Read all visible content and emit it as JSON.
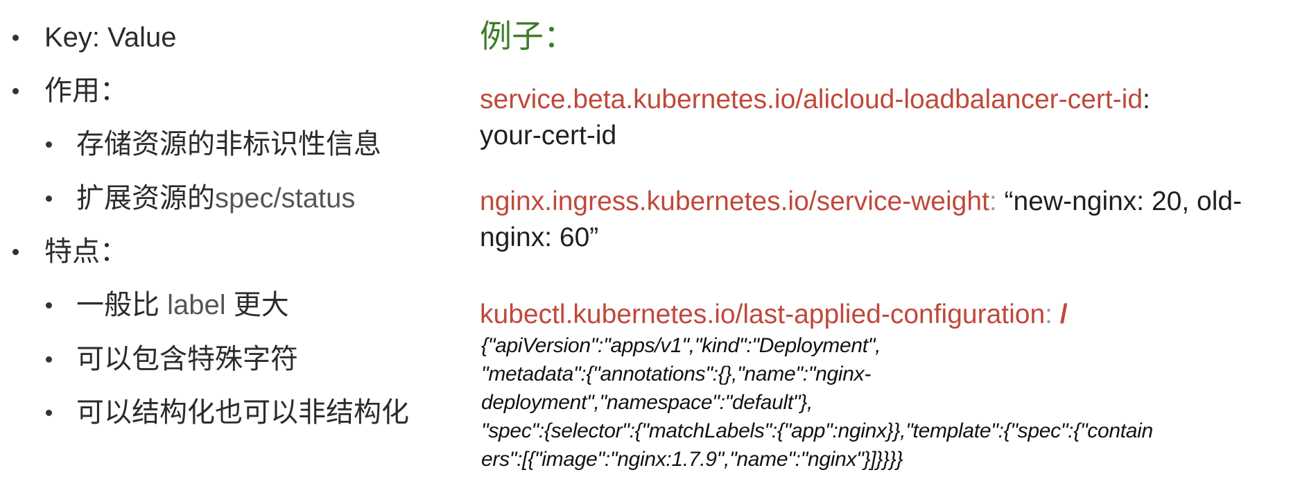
{
  "left_list": {
    "item_key_value": "Key: Value",
    "item_purpose": "作用：",
    "purpose_sub_1": "存储资源的非标识性信息",
    "purpose_sub_2_cn": "扩展资源的",
    "purpose_sub_2_en": "spec/status",
    "item_features": "特点：",
    "features_sub_1_a": "一般比 ",
    "features_sub_1_b": "label",
    "features_sub_1_c": " 更大",
    "features_sub_2": "可以包含特殊字符",
    "features_sub_3": "可以结构化也可以非结构化"
  },
  "example": {
    "heading": "例子：",
    "entry1_key": "service.beta.kubernetes.io/alicloud-loadbalancer-cert-id",
    "entry1_colon": ":",
    "entry1_value": "your-cert-id",
    "entry2_key": "nginx.ingress.kubernetes.io/service-weight",
    "entry2_colon": ":",
    "entry2_value": " “new-nginx: 20, old-nginx: 60”",
    "entry3_key": "kubectl.kubernetes.io/last-applied-configuration",
    "entry3_colon": ":",
    "entry3_slash": " /",
    "entry3_value": "{\"apiVersion\":\"apps/v1\",\"kind\":\"Deployment\",\n\"metadata\":{\"annotations\":{},\"name\":\"nginx-\ndeployment\",\"namespace\":\"default\"},\n\"spec\":{selector\":{\"matchLabels\":{\"app\":nginx}},\"template\":{\"spec\":{\"contain\ners\":[{\"image\":\"nginx:1.7.9\",\"name\":\"nginx\"}]}}}}"
  },
  "colors": {
    "heading_green": "#3e7d2a",
    "key_red": "#c0483a",
    "text_dark": "#1f1f1f",
    "bullet": "#333333"
  }
}
